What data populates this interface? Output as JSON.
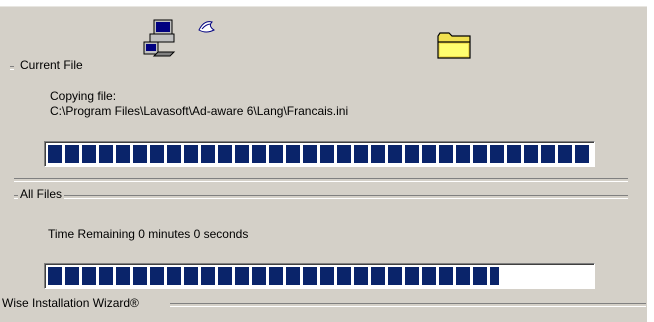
{
  "current_file": {
    "legend": "Current File",
    "status_label": "Copying file:",
    "path": "C:\\Program Files\\Lavasoft\\Ad-aware 6\\Lang\\Francais.ini",
    "progress_fraction": 1.0
  },
  "all_files": {
    "legend": "All Files",
    "time_remaining": "Time Remaining 0 minutes 0 seconds",
    "progress_fraction": 0.83
  },
  "footer": {
    "brand": "Wise Installation Wizard®"
  },
  "icons": {
    "computer": "computer-icon",
    "paper": "flying-paper-icon",
    "folder": "folder-icon"
  }
}
